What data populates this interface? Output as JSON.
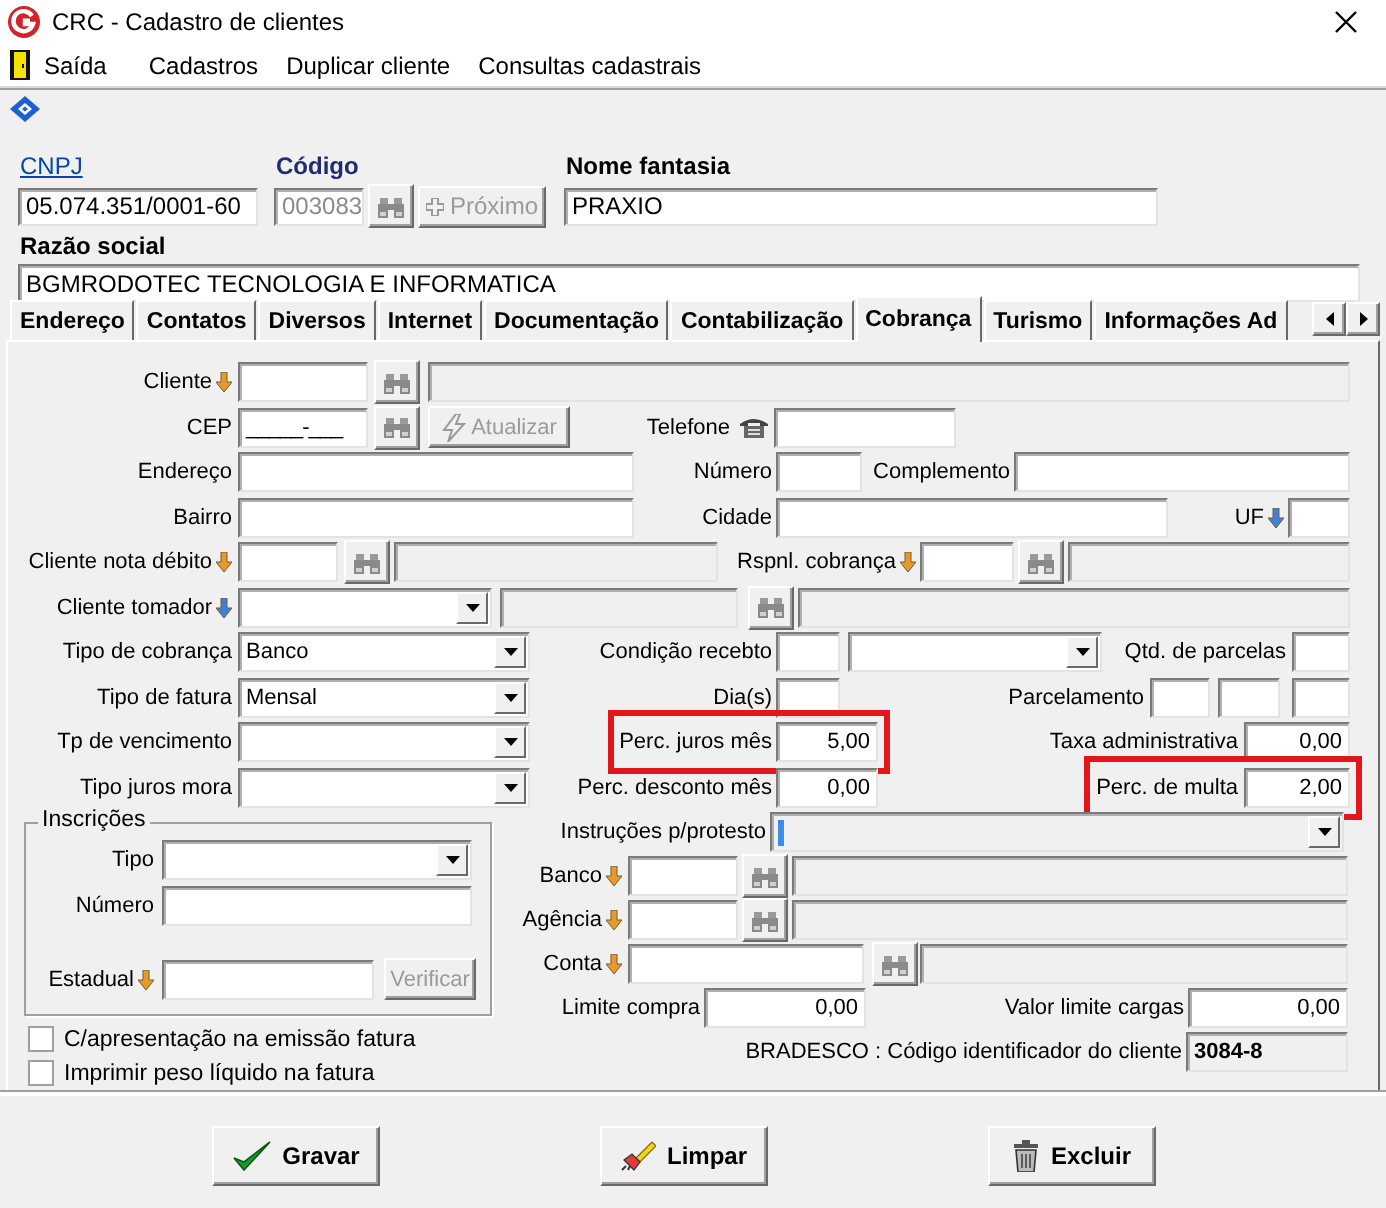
{
  "window": {
    "title": "CRC - Cadastro de clientes"
  },
  "menu": [
    "Saída",
    "Cadastros",
    "Duplicar cliente",
    "Consultas cadastrais"
  ],
  "header": {
    "cnpj": {
      "label": "CNPJ",
      "value": "05.074.351/0001-60"
    },
    "codigo": {
      "label": "Código",
      "value": "003083",
      "disabled": true
    },
    "next_button": {
      "label": "Próximo",
      "disabled": true
    },
    "nome_fantasia": {
      "label": "Nome fantasia",
      "value": "PRAXIO"
    },
    "razao_social": {
      "label": "Razão social",
      "value": "BGMRODOTEC TECNOLOGIA  E INFORMATICA"
    }
  },
  "tabs": [
    {
      "label": "Endereço",
      "selected": false
    },
    {
      "label": "Contatos",
      "selected": false
    },
    {
      "label": "Diversos",
      "selected": false
    },
    {
      "label": "Internet",
      "selected": false
    },
    {
      "label": "Documentação",
      "selected": false
    },
    {
      "label": "Contabilização",
      "selected": false
    },
    {
      "label": "Cobrança",
      "selected": true
    },
    {
      "label": "Turismo",
      "selected": false
    },
    {
      "label": "Informações Ad",
      "selected": false
    }
  ],
  "cobranca": {
    "cliente": "Cliente",
    "cep": {
      "label": "CEP",
      "mask": "_____-___"
    },
    "atualizar": {
      "label": "Atualizar",
      "disabled": true
    },
    "telefone": "Telefone",
    "endereco": "Endereço",
    "numero": "Número",
    "complemento": "Complemento",
    "bairro": "Bairro",
    "cidade": "Cidade",
    "uf": "UF",
    "cliente_nota_debito": "Cliente nota débito",
    "rspnl_cobranca": "Rspnl. cobrança",
    "cliente_tomador": "Cliente tomador",
    "tipo_cobranca": {
      "label": "Tipo de cobrança",
      "value": "Banco"
    },
    "tipo_fatura": {
      "label": "Tipo de fatura",
      "value": "Mensal"
    },
    "tp_vencimento": "Tp de vencimento",
    "tipo_juros_mora": "Tipo juros mora",
    "condicao_recebto": "Condição recebto",
    "dias": "Dia(s)",
    "qtd_parcelas": "Qtd. de parcelas",
    "parcelamento": "Parcelamento",
    "rates": [
      {
        "label": "Perc. juros mês",
        "value": "5,00",
        "highlighted": true
      },
      {
        "label": "Perc. desconto mês",
        "value": "0,00",
        "highlighted": false
      },
      {
        "label": "Taxa administrativa",
        "value": "0,00",
        "highlighted": false
      },
      {
        "label": "Perc. de multa",
        "value": "2,00",
        "highlighted": true
      }
    ],
    "inscricoes": {
      "title": "Inscrições",
      "tipo": "Tipo",
      "numero": "Número",
      "estadual": "Estadual",
      "verificar": {
        "label": "Verificar",
        "disabled": true
      }
    },
    "instrucoes_protesto": "Instruções p/protesto",
    "banco": "Banco",
    "agencia": "Agência",
    "conta": "Conta",
    "limite_compra": {
      "label": "Limite compra",
      "value": "0,00"
    },
    "valor_limite_cargas": {
      "label": "Valor limite cargas",
      "value": "0,00"
    },
    "bradesco": {
      "label": "BRADESCO : Código identificador do cliente",
      "value": "3084-8"
    },
    "options": [
      {
        "label": "C/apresentação na emissão fatura",
        "checked": false
      },
      {
        "label": "Imprimir peso líquido na fatura",
        "checked": false
      }
    ]
  },
  "buttons": [
    {
      "label": "Gravar",
      "kind": "save"
    },
    {
      "label": "Limpar",
      "kind": "clear"
    },
    {
      "label": "Excluir",
      "kind": "delete"
    }
  ]
}
